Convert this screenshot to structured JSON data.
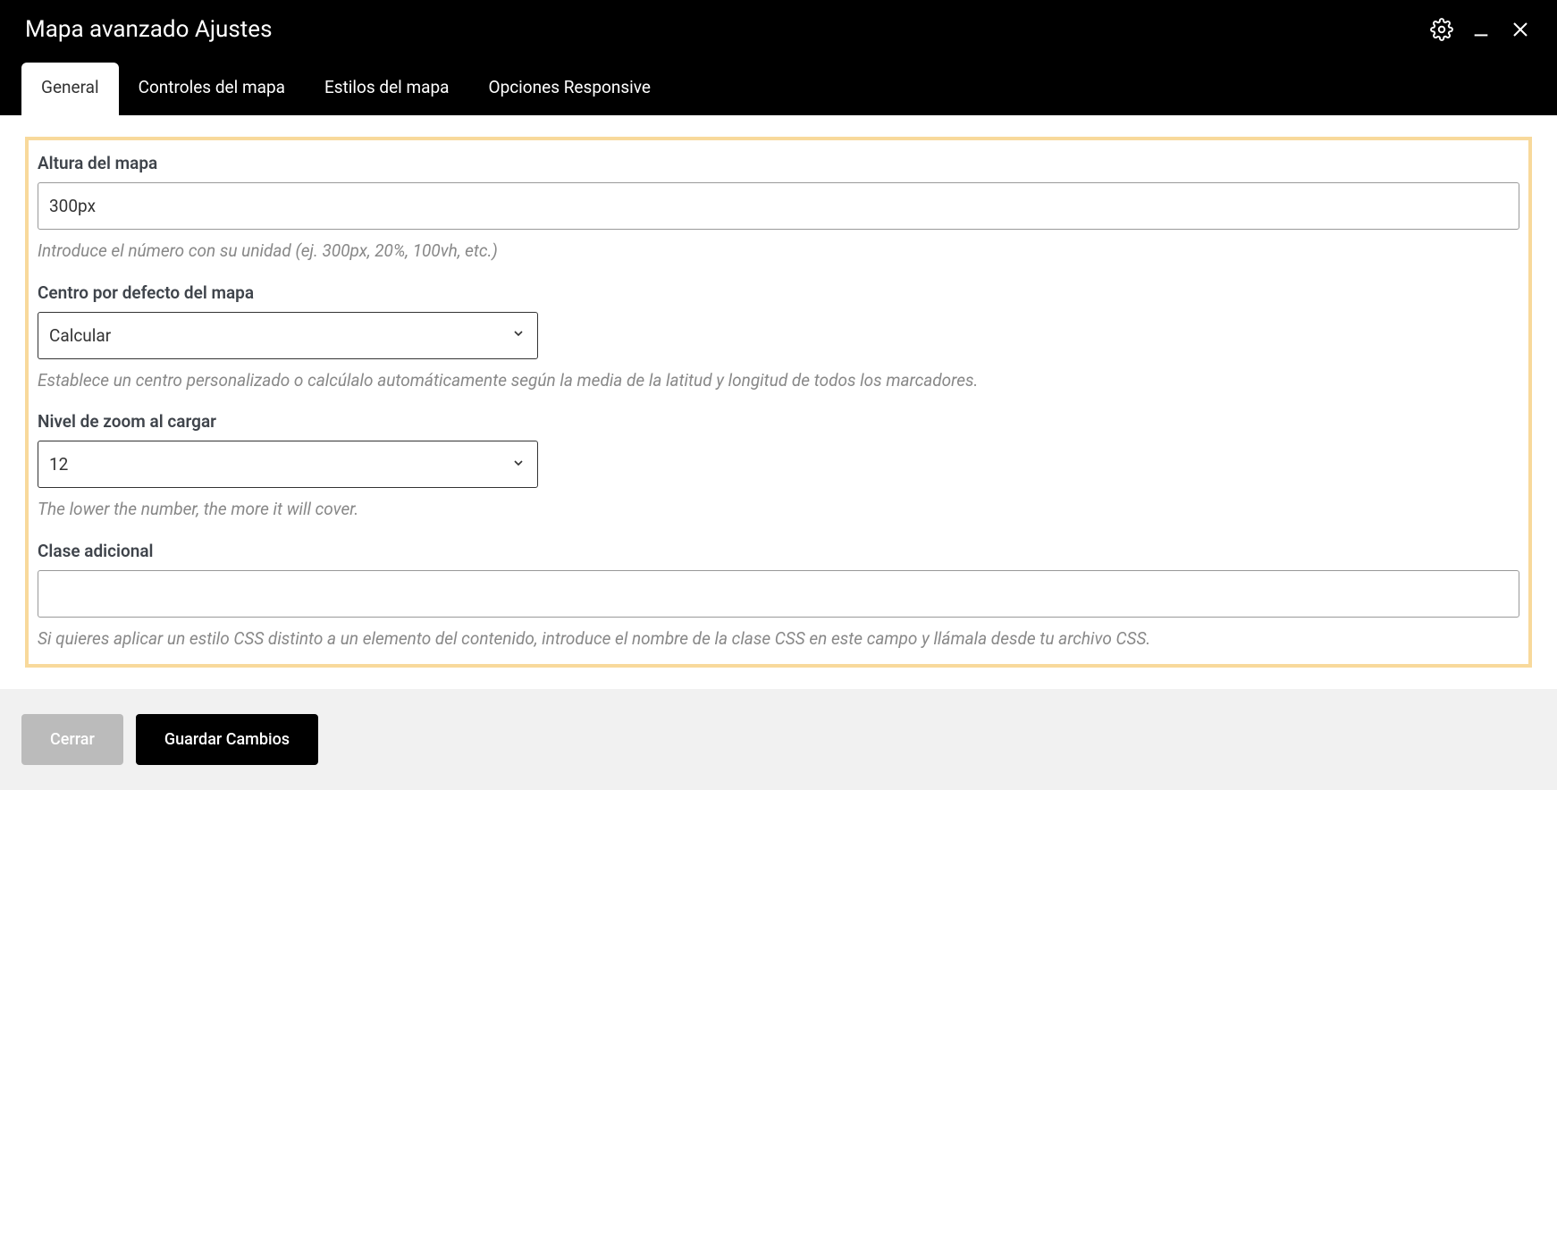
{
  "header": {
    "title": "Mapa avanzado Ajustes"
  },
  "tabs": [
    {
      "label": "General",
      "active": true
    },
    {
      "label": "Controles del mapa",
      "active": false
    },
    {
      "label": "Estilos del mapa",
      "active": false
    },
    {
      "label": "Opciones Responsive",
      "active": false
    }
  ],
  "form": {
    "map_height": {
      "label": "Altura del mapa",
      "value": "300px",
      "help": "Introduce el número con su unidad (ej. 300px, 20%, 100vh, etc.)"
    },
    "map_center": {
      "label": "Centro por defecto del mapa",
      "value": "Calcular",
      "help": "Establece un centro personalizado o calcúlalo automáticamente según la media de la latitud y longitud de todos los marcadores."
    },
    "zoom_level": {
      "label": "Nivel de zoom al cargar",
      "value": "12",
      "help": "The lower the number, the more it will cover."
    },
    "additional_class": {
      "label": "Clase adicional",
      "value": "",
      "help": "Si quieres aplicar un estilo CSS distinto a un elemento del contenido, introduce el nombre de la clase CSS en este campo y llámala desde tu archivo CSS."
    }
  },
  "footer": {
    "close_label": "Cerrar",
    "save_label": "Guardar Cambios"
  }
}
